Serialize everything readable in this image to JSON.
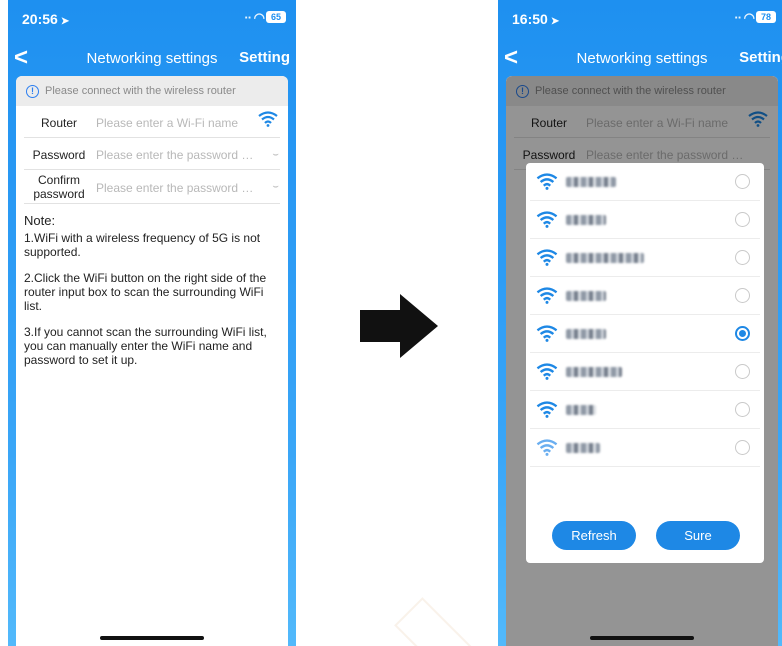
{
  "left": {
    "status": {
      "time": "20:56",
      "battery": "65"
    },
    "nav": {
      "back": "<",
      "title": "Networking settings",
      "setting": "Setting"
    },
    "tip": "Please connect with the wireless router",
    "router": {
      "label": "Router",
      "placeholder": "Please enter a Wi-Fi name"
    },
    "password": {
      "label": "Password",
      "placeholder": "Please enter the password of t..."
    },
    "confirm": {
      "label_line1": "Confirm",
      "label_line2": "password",
      "placeholder": "Please enter the password of t..."
    },
    "note": {
      "heading": "Note:",
      "line1": "1.WiFi with a wireless frequency of 5G is not supported.",
      "line2": "2.Click the WiFi button on the right side of the router input box to scan the surrounding WiFi list.",
      "line3": "3.If you cannot scan the surrounding WiFi list, you can manually enter the WiFi name and password to set it up."
    }
  },
  "right": {
    "status": {
      "time": "16:50",
      "battery": "78"
    },
    "nav": {
      "back": "<",
      "title": "Networking settings",
      "setting": "Setting"
    },
    "tip": "Please connect with the wireless router",
    "router": {
      "label": "Router",
      "placeholder": "Please enter a Wi-Fi name"
    },
    "password": {
      "label": "Password",
      "placeholder": "Please enter the password of t..."
    },
    "dialog": {
      "networks_selected_index": 4,
      "network_count": 8,
      "refresh": "Refresh",
      "sure": "Sure"
    }
  },
  "colors": {
    "accent": "#1e88e5",
    "header": "#1e90f0"
  }
}
